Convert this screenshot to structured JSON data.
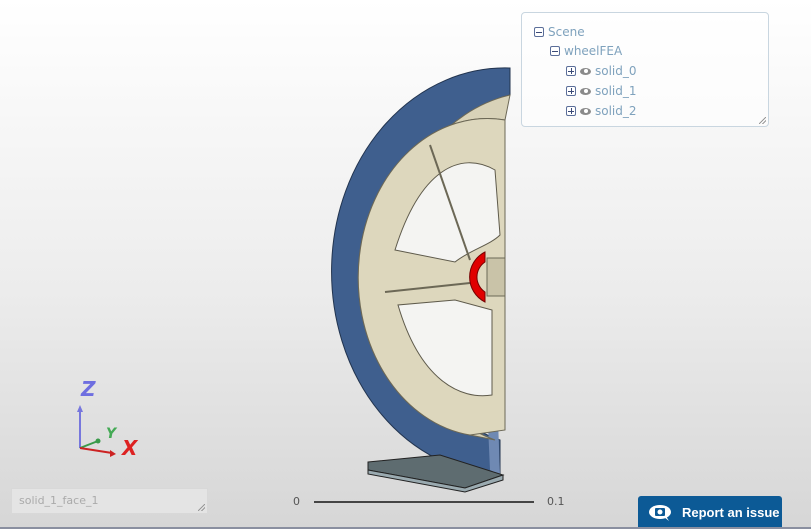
{
  "tree": {
    "root": "Scene",
    "model": "wheelFEA",
    "solids": [
      "solid_0",
      "solid_1",
      "solid_2"
    ]
  },
  "axes": {
    "z": "Z",
    "y": "Y",
    "x": "X"
  },
  "selection": {
    "value": "solid_1_face_1"
  },
  "scale": {
    "min": "0",
    "max": "0.1"
  },
  "report_button": {
    "label": "Report an issue"
  },
  "colors": {
    "tire": "#3e5f8f",
    "rim": "#d6d0b6",
    "hub": "#e00000",
    "button": "#0c5a96"
  }
}
